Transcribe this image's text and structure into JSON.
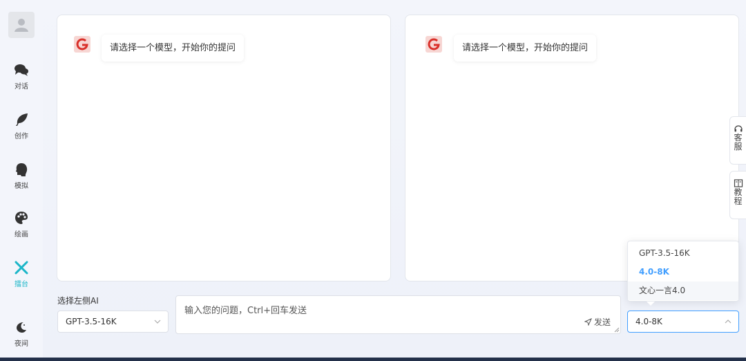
{
  "sidebar": {
    "items": [
      {
        "label": "对话",
        "icon": "chat-icon"
      },
      {
        "label": "创作",
        "icon": "feather-icon"
      },
      {
        "label": "模拟",
        "icon": "head-icon"
      },
      {
        "label": "绘画",
        "icon": "palette-icon"
      },
      {
        "label": "擂台",
        "icon": "crossed-swords-icon",
        "active": true
      },
      {
        "label": "夜间",
        "icon": "moon-icon"
      }
    ]
  },
  "panels": {
    "left": {
      "message": "请选择一个模型，开始你的提问"
    },
    "right": {
      "message": "请选择一个模型，开始你的提问"
    }
  },
  "left_select": {
    "label": "选择左侧AI",
    "value": "GPT-3.5-16K"
  },
  "right_select": {
    "value": "4.0-8K"
  },
  "input": {
    "placeholder": "输入您的问题，Ctrl+回车发送",
    "send_label": "发送"
  },
  "dropdown": {
    "options": [
      "GPT-3.5-16K",
      "4.0-8K",
      "文心一言4.0"
    ],
    "selected": "4.0-8K"
  },
  "float_tabs": {
    "service": "客服",
    "tutorial": "教程"
  },
  "colors": {
    "accent": "#409eff",
    "active_nav": "#1bb6c8",
    "logo_red": "#d9302a"
  }
}
